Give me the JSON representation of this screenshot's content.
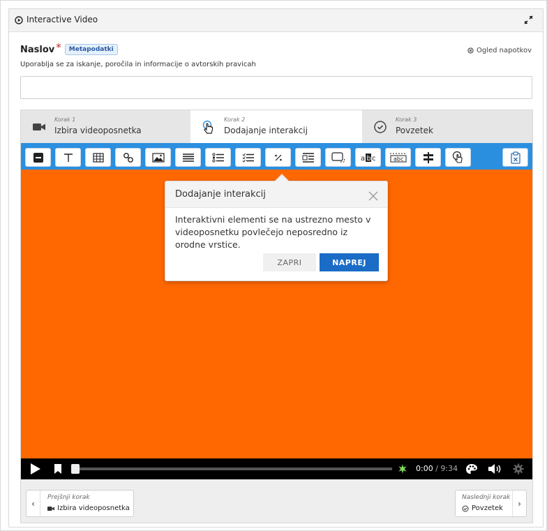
{
  "header": {
    "title": "Interactive Video"
  },
  "field": {
    "label": "Naslov",
    "required_mark": "*",
    "metadata_button": "Metapodatki",
    "tips_link": "Ogled napotkov",
    "description": "Uporablja se za iskanje, poročila in informacije o avtorskih pravicah",
    "value": ""
  },
  "tabs": [
    {
      "step": "Korak 1",
      "name": "Izbira videoposnetka"
    },
    {
      "step": "Korak 2",
      "name": "Dodajanje interakcij"
    },
    {
      "step": "Korak 3",
      "name": "Povzetek"
    }
  ],
  "toolbar": {
    "icons": [
      "label-icon",
      "text-icon",
      "table-icon",
      "link-icon",
      "image-icon",
      "statements-icon",
      "single-choice-icon",
      "multiple-choice-icon",
      "fill-blanks-icon",
      "drag-text-icon",
      "summary-icon",
      "mark-words-icon",
      "drag-drop-icon",
      "crossroads-icon",
      "navigation-hotspot-icon"
    ]
  },
  "popover": {
    "title": "Dodajanje interakcij",
    "body": "Interaktivni elementi se na ustrezno mesto v videoposnetku povlečejo neposredno iz orodne vrstice.",
    "close_label": "ZAPRI",
    "next_label": "NAPREJ"
  },
  "player": {
    "current_time": "0:00",
    "separator": " / ",
    "duration": "9:34",
    "video_color": "#ff6800"
  },
  "footer": {
    "prev_caption": "Prejšnji korak",
    "prev_step": "Izbira videoposnetka",
    "next_caption": "Naslednji korak",
    "next_step": "Povzetek"
  },
  "colors": {
    "accent": "#2b8fe0",
    "primary_button": "#1a6cc7",
    "required": "#c62828"
  }
}
